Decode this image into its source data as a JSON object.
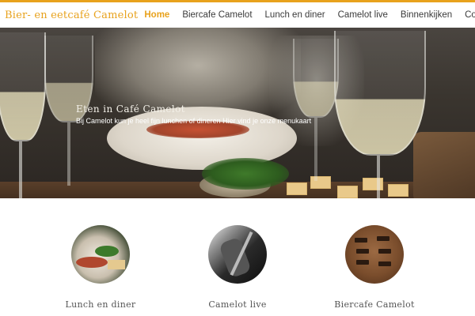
{
  "brand": {
    "logo_text": "Bier- en eetcafé Camelot",
    "accent_color": "#e8a21d"
  },
  "nav": {
    "items": [
      {
        "label": "Home",
        "active": true
      },
      {
        "label": "Biercafe Camelot",
        "active": false
      },
      {
        "label": "Lunch en diner",
        "active": false
      },
      {
        "label": "Camelot live",
        "active": false
      },
      {
        "label": "Binnenkijken",
        "active": false
      },
      {
        "label": "Contact",
        "active": false
      }
    ]
  },
  "hero": {
    "title": "Eten in Café Camelot",
    "subtitle": "Bij Camelot kun je heel fijn lunchen of dineren Hier vind je onze menukaart"
  },
  "cards": [
    {
      "title": "Lunch en diner",
      "image": "food-plate-photo"
    },
    {
      "title": "Camelot live",
      "image": "live-music-photo"
    },
    {
      "title": "Biercafe Camelot",
      "image": "beer-signs-photo"
    }
  ]
}
